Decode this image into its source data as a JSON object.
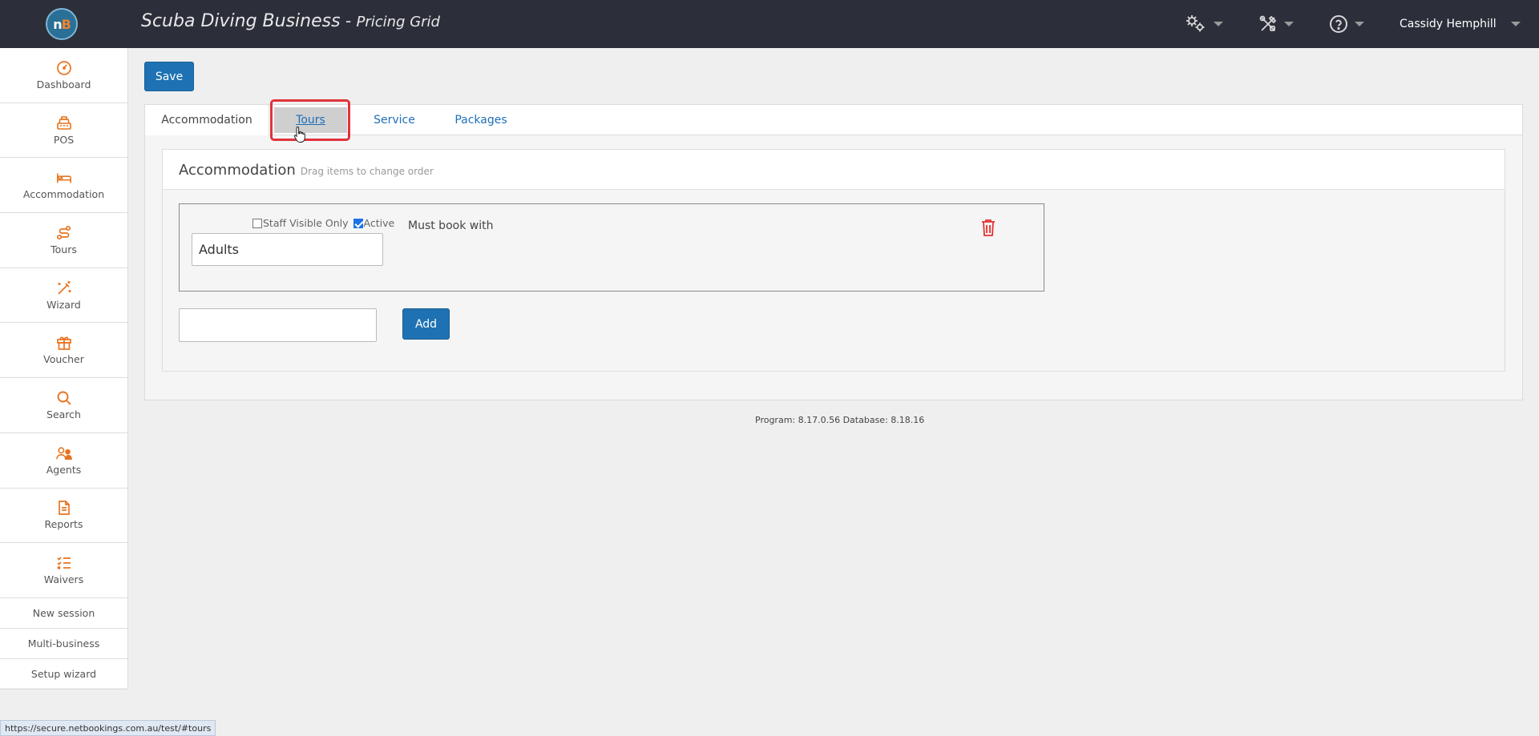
{
  "header": {
    "app_name": "Scuba Diving Business",
    "separator": " - ",
    "page_name": "Pricing Grid",
    "logo_text": "nB",
    "user_name": "Cassidy Hemphill",
    "icons": [
      "settings-gears-icon",
      "tools-icon",
      "help-icon"
    ]
  },
  "sidebar": {
    "items": [
      {
        "label": "Dashboard",
        "icon": "dashboard-icon"
      },
      {
        "label": "POS",
        "icon": "cash-register-icon"
      },
      {
        "label": "Accommodation",
        "icon": "bed-icon"
      },
      {
        "label": "Tours",
        "icon": "route-icon"
      },
      {
        "label": "Wizard",
        "icon": "magic-wand-icon"
      },
      {
        "label": "Voucher",
        "icon": "gift-icon"
      },
      {
        "label": "Search",
        "icon": "search-icon"
      },
      {
        "label": "Agents",
        "icon": "agents-icon"
      },
      {
        "label": "Reports",
        "icon": "report-icon"
      },
      {
        "label": "Waivers",
        "icon": "checklist-icon"
      }
    ],
    "text_links": [
      "New session",
      "Multi-business",
      "Setup wizard"
    ]
  },
  "toolbar": {
    "save_label": "Save"
  },
  "tabs": [
    {
      "label": "Accommodation",
      "state": "active"
    },
    {
      "label": "Tours",
      "state": "hover"
    },
    {
      "label": "Service",
      "state": "normal"
    },
    {
      "label": "Packages",
      "state": "normal"
    }
  ],
  "section": {
    "title": "Accommodation",
    "hint": "Drag items to change order"
  },
  "item": {
    "staff_visible_label": "Staff Visible Only",
    "staff_visible_checked": false,
    "active_label": "Active",
    "active_checked": true,
    "name_value": "Adults",
    "must_book_label": "Must book with"
  },
  "new_item": {
    "value": "",
    "add_label": "Add"
  },
  "footer": {
    "version_text": "Program: 8.17.0.56 Database: 8.18.16"
  },
  "status_bar": {
    "url": "https://secure.netbookings.com.au/test/#tours"
  },
  "colors": {
    "topbar": "#2c2f3a",
    "accent_orange": "#f0822c",
    "primary_blue": "#1e72b3",
    "link_blue": "#1e6fb8",
    "highlight_red": "#e0333a",
    "trash_red": "#e53030"
  }
}
